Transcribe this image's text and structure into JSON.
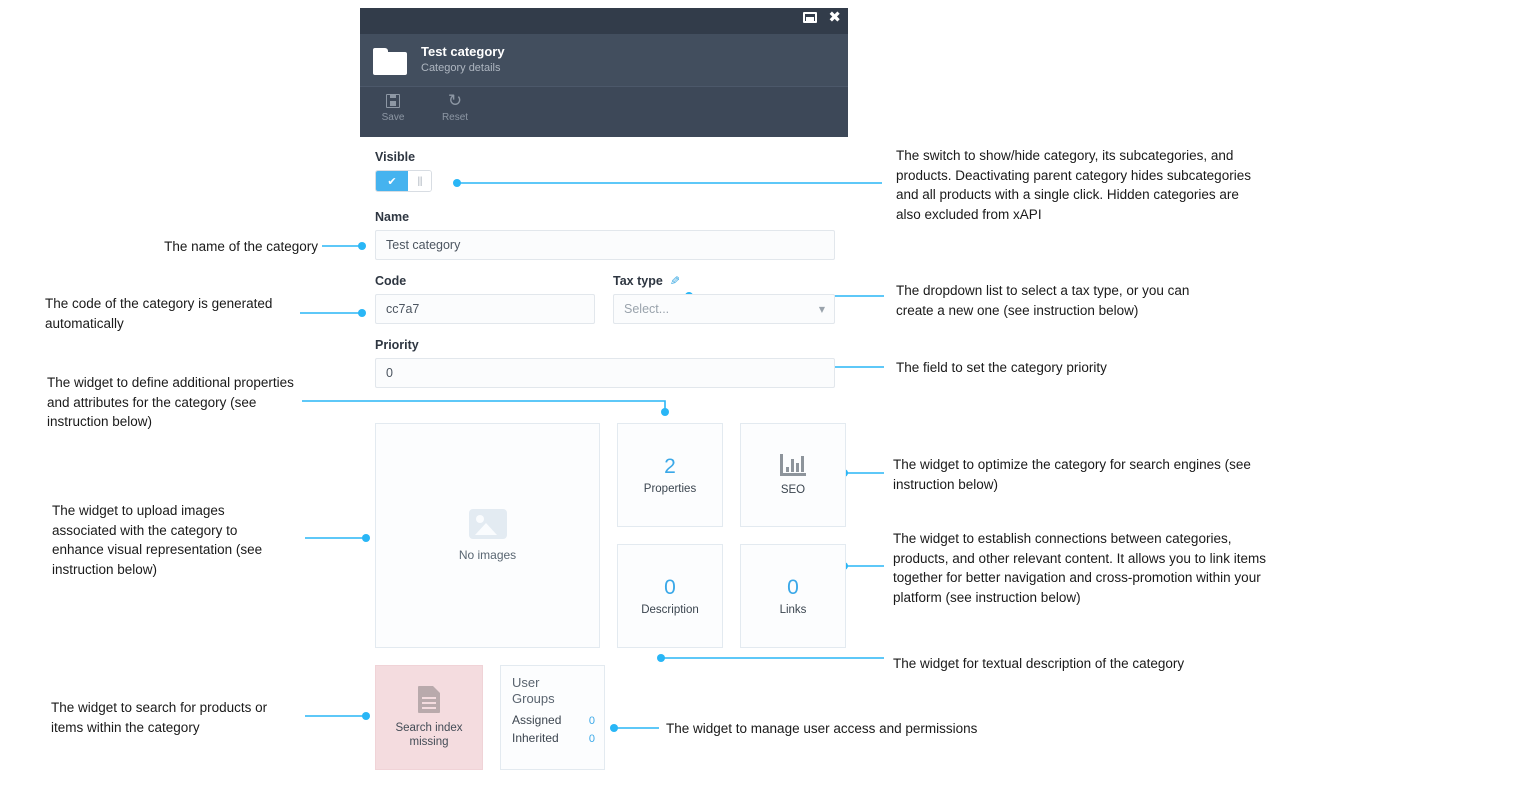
{
  "window": {
    "title": "Test category",
    "subtitle": "Category details",
    "restore_icon": "restore-window-icon",
    "close_icon": "close-icon",
    "folder_icon": "folder-icon",
    "toolbar": {
      "save_label": "Save",
      "save_icon": "save-floppy-icon",
      "reset_label": "Reset",
      "reset_icon": "reset-undo-icon"
    }
  },
  "form": {
    "visible_label": "Visible",
    "visible_on_glyph": "✔",
    "visible_knob_glyph": "|||",
    "name_label": "Name",
    "name_value": "Test category",
    "code_label": "Code",
    "code_value": "cc7a7",
    "tax_label": "Tax type",
    "tax_edit_icon": "pencil-edit-icon",
    "tax_value": "Select...",
    "tax_caret": "▼",
    "priority_label": "Priority",
    "priority_value": "0"
  },
  "tiles": {
    "images": {
      "placeholder_icon": "image-placeholder-icon",
      "label": "No images"
    },
    "properties": {
      "count": "2",
      "label": "Properties"
    },
    "seo": {
      "icon": "seo-bar-chart-icon",
      "label": "SEO"
    },
    "description": {
      "count": "0",
      "label": "Description"
    },
    "links": {
      "count": "0",
      "label": "Links"
    },
    "search_index": {
      "icon": "document-icon",
      "line1": "Search index",
      "line2": "missing"
    },
    "user_groups": {
      "title_line1": "User",
      "title_line2": "Groups",
      "assigned_label": "Assigned",
      "assigned_value": "0",
      "inherited_label": "Inherited",
      "inherited_value": "0"
    }
  },
  "annotations": {
    "visible": "The switch to show/hide category, its subcategories, and products. Deactivating parent category hides subcategories and all products with a single click. Hidden categories are also excluded from xAPI",
    "name": "The name of the category",
    "code": "The code of the category is generated automatically",
    "tax_type": "The dropdown list to select a tax type, or you can create a new one (see instruction below)",
    "priority": "The field to set the category priority",
    "properties": "The widget to define additional properties and attributes for the category (see instruction below)",
    "images": "The widget to upload images associated with the category to enhance visual representation (see instruction below)",
    "seo": "The widget to optimize the category for search engines (see instruction below)",
    "links": "The widget to establish connections between categories, products, and other relevant content. It allows you to link items together for better navigation and cross-promotion within your platform (see instruction below)",
    "description": "The widget for textual description of the category",
    "search_index": "The widget to search for products or items within the category",
    "user_groups": "The widget to manage user access and permissions"
  },
  "colors": {
    "accent": "#29b6f6",
    "titlebar": "#323c4a",
    "header": "#424e5e",
    "toolbar": "#3d4858",
    "tile_number": "#3aa8e8",
    "search_index_bg": "#f4dcdf"
  }
}
